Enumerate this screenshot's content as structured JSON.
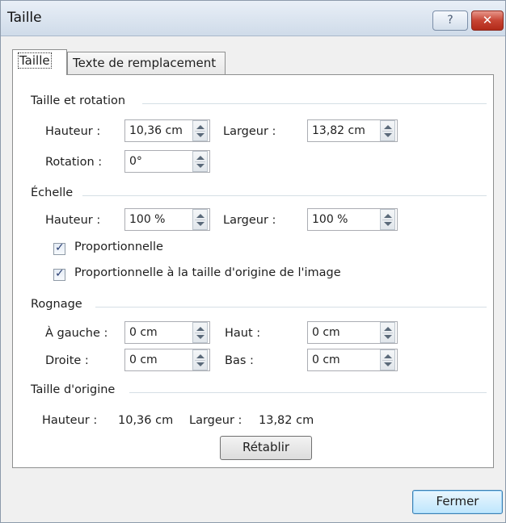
{
  "window": {
    "title": "Taille",
    "help_label": "?",
    "close_label": "✕"
  },
  "tabs": [
    {
      "label": "Taille"
    },
    {
      "label": "Texte de remplacement"
    }
  ],
  "sections": {
    "size_rotation": "Taille et rotation",
    "scale": "Échelle",
    "crop": "Rognage",
    "original_size": "Taille d'origine"
  },
  "size_rotation": {
    "height_label": "Hauteur :",
    "height_value": "10,36 cm",
    "width_label": "Largeur :",
    "width_value": "13,82 cm",
    "rotation_label": "Rotation :",
    "rotation_value": "0°"
  },
  "scale": {
    "height_label": "Hauteur :",
    "height_value": "100 %",
    "width_label": "Largeur :",
    "width_value": "100 %",
    "lock_ratio_label": "Proportionnelle",
    "lock_ratio_checked": true,
    "relative_original_label": "Proportionnelle à la taille d'origine de l'image",
    "relative_original_checked": true
  },
  "crop": {
    "left_label": "À gauche :",
    "left_value": "0 cm",
    "top_label": "Haut :",
    "top_value": "0 cm",
    "right_label": "Droite :",
    "right_value": "0 cm",
    "bottom_label": "Bas :",
    "bottom_value": "0 cm"
  },
  "original": {
    "height_label": "Hauteur :",
    "height_value": "10,36 cm",
    "width_label": "Largeur :",
    "width_value": "13,82 cm",
    "reset_label": "Rétablir"
  },
  "footer": {
    "close_label": "Fermer"
  }
}
